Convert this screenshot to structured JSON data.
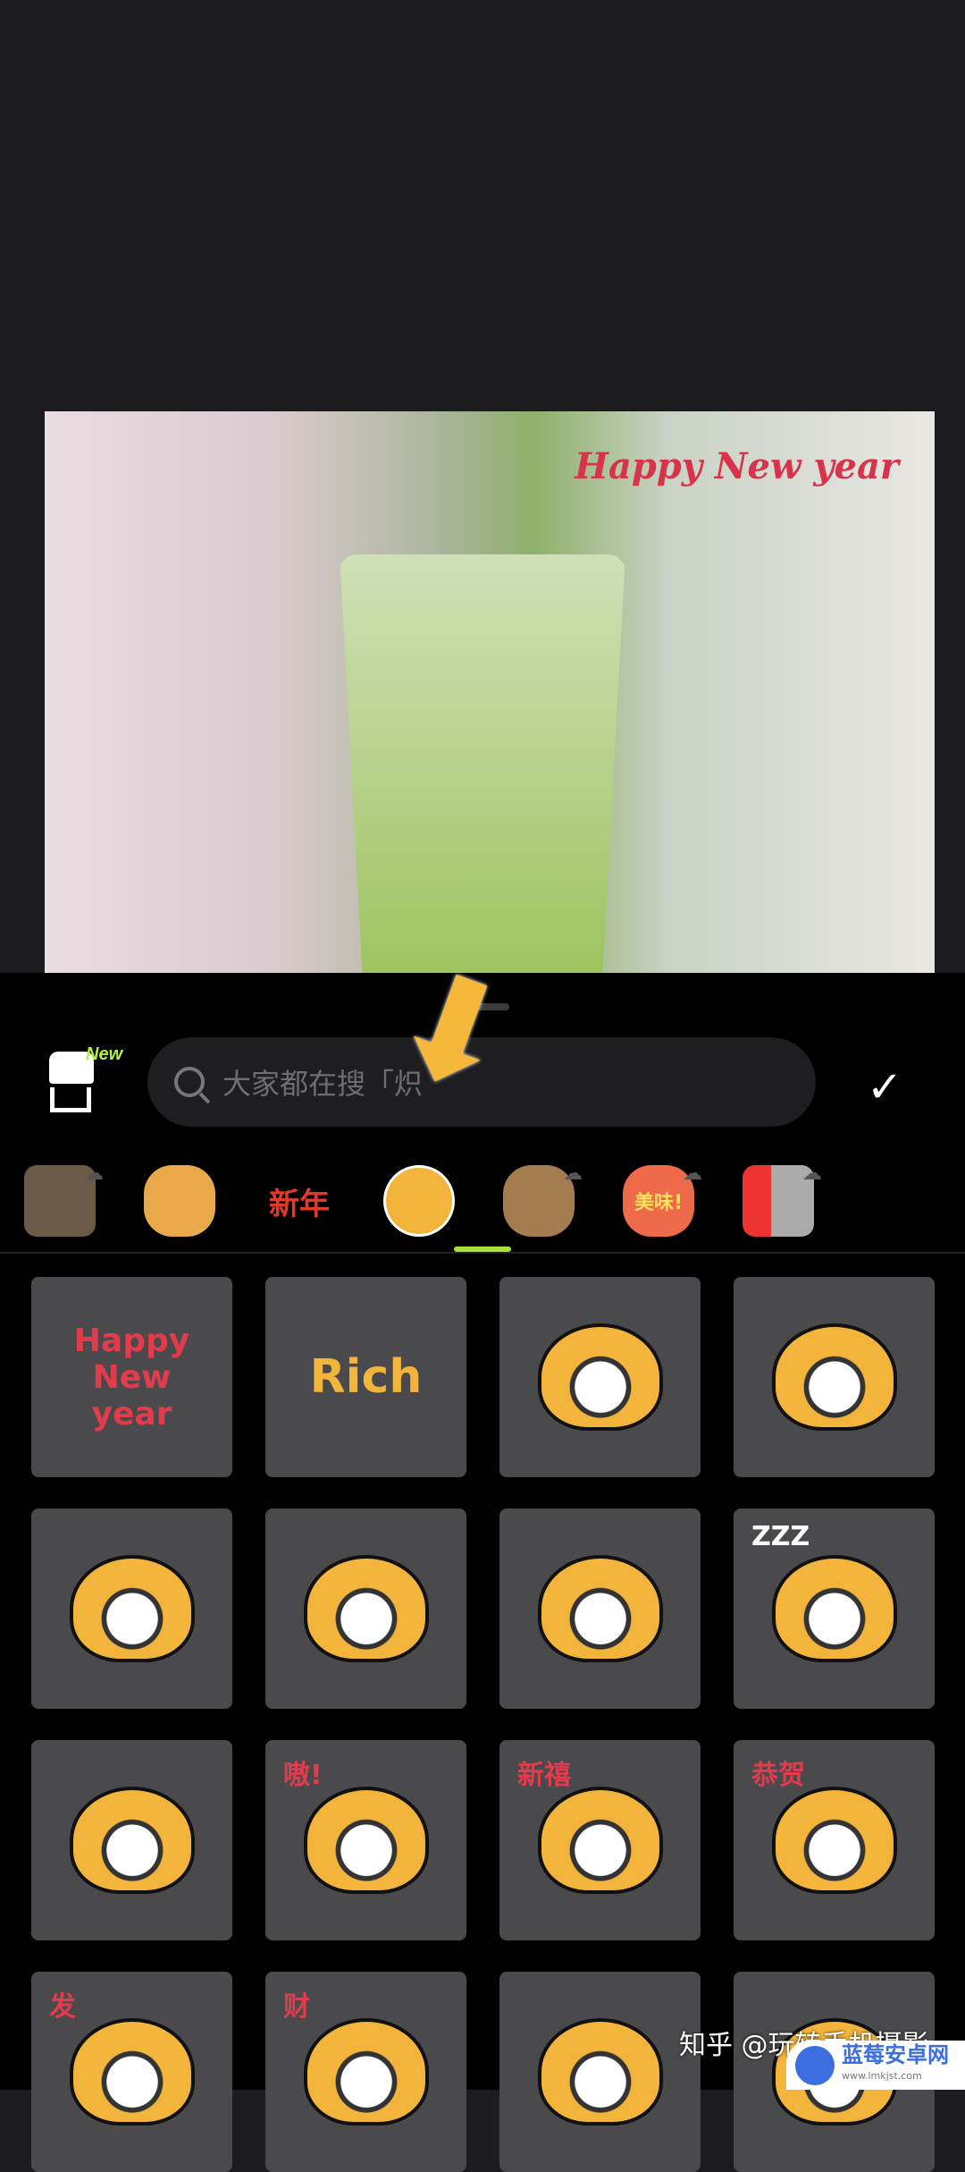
{
  "photo": {
    "sticker_text": "Happy New year"
  },
  "panel": {
    "store_badge": "New",
    "search_placeholder": "大家都在搜「炽",
    "confirm_icon": "check-icon",
    "tabs": [
      {
        "label": "",
        "icon": "tiger-photo"
      },
      {
        "label": "",
        "icon": "fat-tiger"
      },
      {
        "label": "新年",
        "icon": "new-year-text"
      },
      {
        "label": "",
        "icon": "tiger-cat",
        "selected": true
      },
      {
        "label": "",
        "icon": "teddy-bear"
      },
      {
        "label": "美味!",
        "icon": "delicious-text"
      },
      {
        "label": "",
        "icon": "gift-cat"
      }
    ],
    "accent": "#a6e33a",
    "stickers": [
      {
        "text": "Happy New year"
      },
      {
        "text": "Rich"
      },
      {
        "text": ""
      },
      {
        "text": ""
      },
      {
        "text": ""
      },
      {
        "text": ""
      },
      {
        "text": ""
      },
      {
        "text": "ZZZ"
      },
      {
        "text": ""
      },
      {
        "text": "嗷!"
      },
      {
        "text": "新禧"
      },
      {
        "text": "恭贺"
      },
      {
        "text": "发"
      },
      {
        "text": "财"
      },
      {
        "text": ""
      },
      {
        "text": ""
      }
    ]
  },
  "watermark": {
    "text": "知乎 @玩转手机摄影",
    "site_name": "蓝莓安卓网",
    "site_url": "www.lmkjst.com"
  }
}
